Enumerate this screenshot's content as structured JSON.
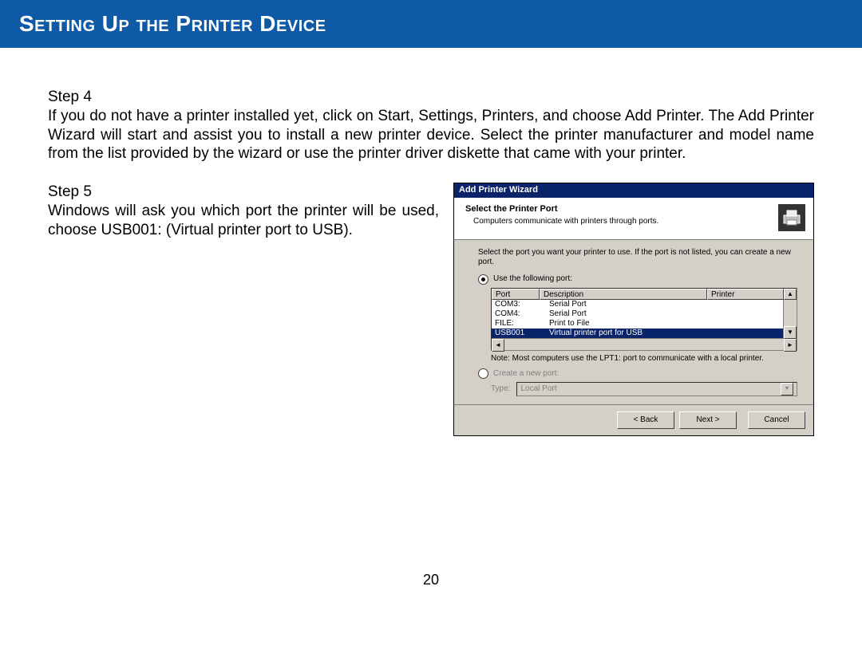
{
  "header": {
    "title": "Setting Up the Printer Device"
  },
  "step4": {
    "label": "Step 4",
    "body": "If you do not have a printer installed yet, click on Start, Settings, Printers, and choose Add Printer.  The Add Printer Wizard will start and assist you to install a new printer device.  Select the printer manufacturer and model name from the list provided by the wizard or use the printer driver diskette that came with your printer."
  },
  "step5": {
    "label": "Step 5",
    "body": "Windows will ask you which port the printer will be used, choose USB001: (Virtual printer port to USB)."
  },
  "wizard": {
    "title": "Add Printer Wizard",
    "subhead_title": "Select the Printer Port",
    "subhead_desc": "Computers communicate with printers through ports.",
    "instruction": "Select the port you want your printer to use. If the port is not listed, you can create a new port.",
    "radio_use": "Use the following port:",
    "radio_create": "Create a new port:",
    "cols": {
      "port": "Port",
      "desc": "Description",
      "printer": "Printer"
    },
    "rows": [
      {
        "port": "COM3:",
        "desc": "Serial Port",
        "printer": ""
      },
      {
        "port": "COM4:",
        "desc": "Serial Port",
        "printer": ""
      },
      {
        "port": "FILE:",
        "desc": "Print to File",
        "printer": ""
      },
      {
        "port": "USB001",
        "desc": "Virtual printer port for USB",
        "printer": ""
      }
    ],
    "selected_index": 3,
    "note": "Note: Most computers use the LPT1: port to communicate with a local printer.",
    "type_label": "Type:",
    "type_value": "Local Port",
    "buttons": {
      "back": "< Back",
      "next": "Next >",
      "cancel": "Cancel"
    }
  },
  "page_number": "20"
}
